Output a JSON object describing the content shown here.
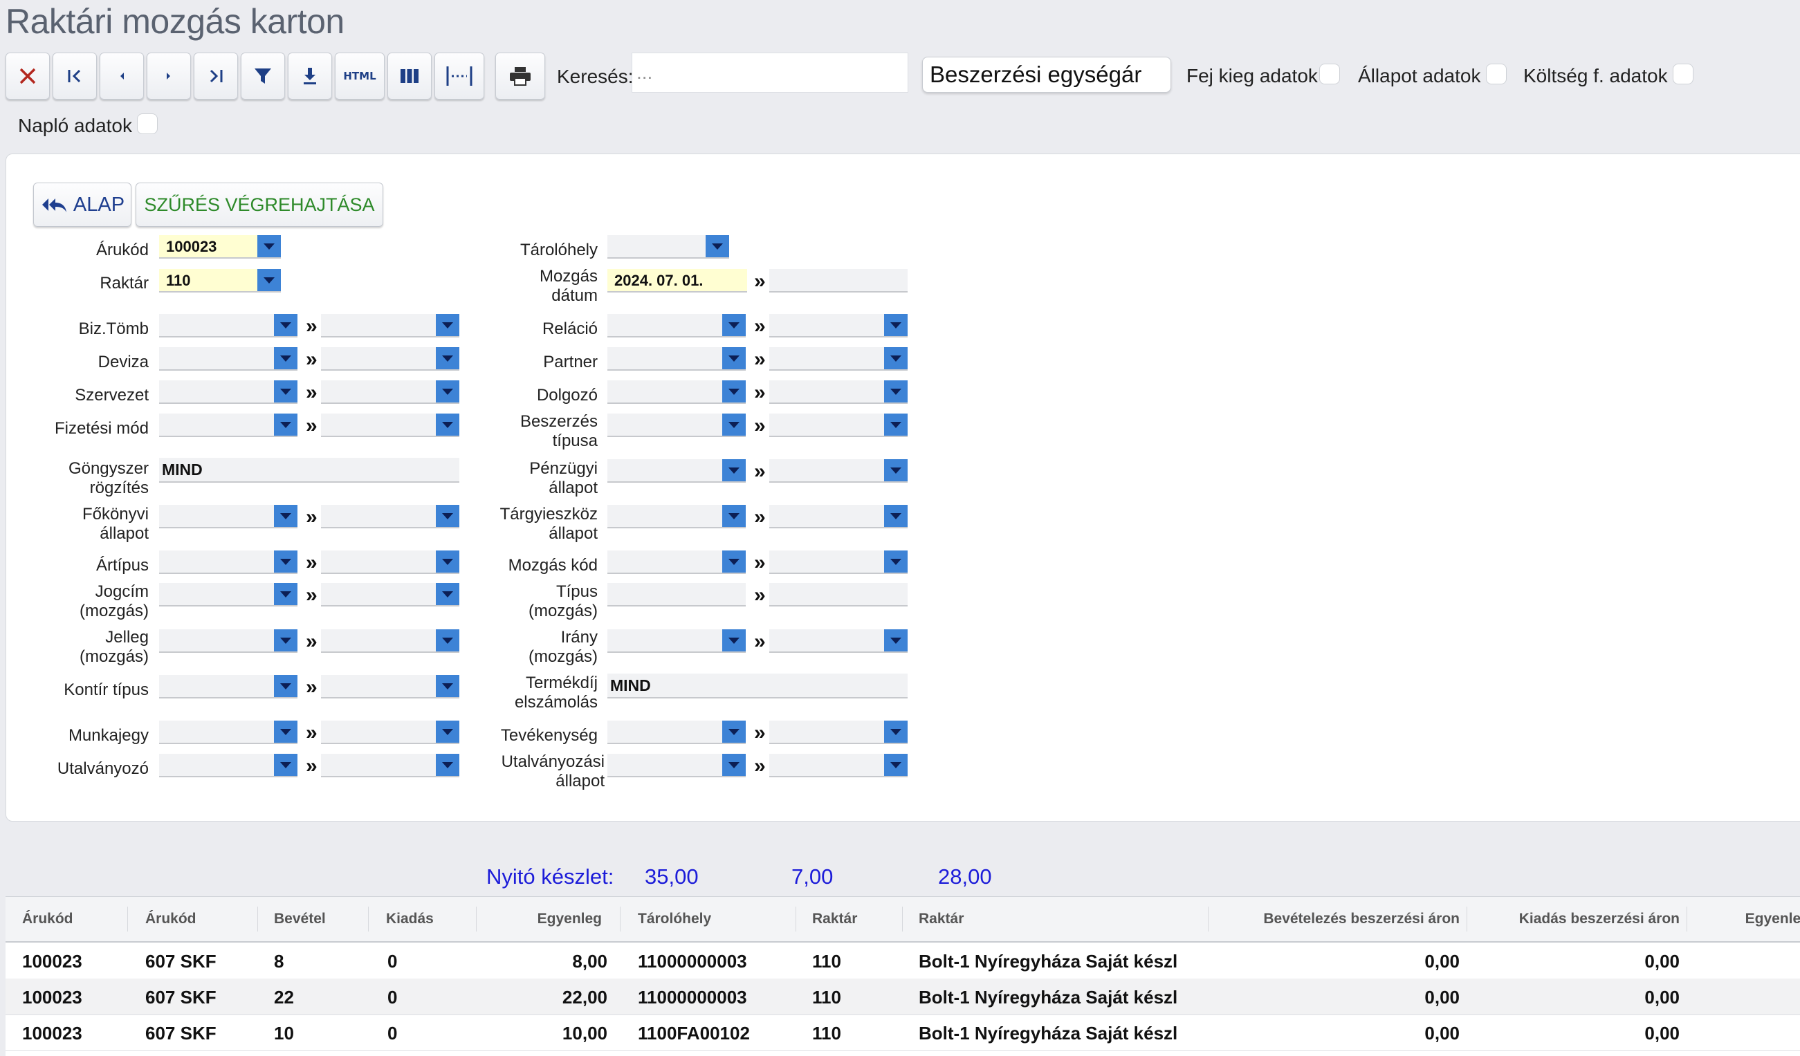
{
  "page": {
    "title": "Raktári mozgás karton"
  },
  "toolbar": {
    "buttons": [
      {
        "icon": "close-icon"
      },
      {
        "icon": "first-page-icon"
      },
      {
        "icon": "prev-icon"
      },
      {
        "icon": "next-icon"
      },
      {
        "icon": "last-page-icon"
      },
      {
        "icon": "filter-icon"
      },
      {
        "icon": "download-icon"
      },
      {
        "icon": "html-export-icon",
        "label": "HTML"
      },
      {
        "icon": "columns-icon"
      },
      {
        "icon": "column-width-icon"
      },
      {
        "icon": "print-icon"
      }
    ],
    "search_label": "Keresés:",
    "search_placeholder": "...",
    "price_select": "Beszerzési egységár",
    "checkboxes": {
      "fej": "Fej kieg adatok",
      "allapot": "Állapot adatok",
      "koltseg": "Költség f. adatok",
      "naplo": "Napló adatok"
    }
  },
  "panel": {
    "alap_label": "ALAP",
    "szures_label": "SZŰRÉS VÉGREHAJTÁSA",
    "left": {
      "arukod": {
        "label": "Árukód",
        "value": "100023"
      },
      "raktar": {
        "label": "Raktár",
        "value": "110"
      },
      "biz_tomb": "Biz.Tömb",
      "deviza": "Deviza",
      "szervezet": "Szervezet",
      "fizetesi_mod": "Fizetési mód",
      "gongyszer": {
        "label1": "Göngyszer",
        "label2": "rögzítés",
        "value": "MIND"
      },
      "fokonyvi": {
        "label1": "Főkönyvi",
        "label2": "állapot"
      },
      "artipus": "Ártípus",
      "jogcim": {
        "label1": "Jogcím",
        "label2": "(mozgás)"
      },
      "jelleg": {
        "label1": "Jelleg",
        "label2": "(mozgás)"
      },
      "kontir": "Kontír típus",
      "munkajegy": "Munkajegy",
      "utalvanyozo": "Utalványozó"
    },
    "right": {
      "tarolohely": "Tárolóhely",
      "mozgas_datum": {
        "label1": "Mozgás",
        "label2": "dátum",
        "value": "2024. 07. 01."
      },
      "relacio": "Reláció",
      "partner": "Partner",
      "dolgozo": "Dolgozó",
      "beszerzes": {
        "label1": "Beszerzés",
        "label2": "típusa"
      },
      "penzugyi": {
        "label1": "Pénzügyi",
        "label2": "állapot"
      },
      "targyieszkoz": {
        "label1": "Tárgyieszköz",
        "label2": "állapot"
      },
      "mozgas_kod": "Mozgás kód",
      "tipus": {
        "label1": "Típus",
        "label2": "(mozgás)"
      },
      "irany": {
        "label1": "Irány",
        "label2": "(mozgás)"
      },
      "termekdij": {
        "label1": "Termékdíj",
        "label2": "elszámolás",
        "value": "MIND"
      },
      "tevekenyseg": "Tevékenység",
      "utalvanyozasi": {
        "label1": "Utalványozási",
        "label2": "állapot"
      }
    },
    "range_sep": "»"
  },
  "summary": {
    "label": "Nyitó készlet:",
    "v1": "35,00",
    "v2": "7,00",
    "v3": "28,00"
  },
  "grid": {
    "headers": [
      "Árukód",
      "Árukód",
      "Bevétel",
      "Kiadás",
      "Egyenleg",
      "Tárolóhely",
      "Raktár",
      "Raktár",
      "Bevételezés beszerzési áron",
      "Kiadás beszerzési áron",
      "Egyenleg"
    ],
    "rows": [
      [
        "100023",
        "607 SKF",
        "8",
        "0",
        "8,00",
        "11000000003",
        "110",
        "Bolt-1 Nyíregyháza Saját készl",
        "0,00",
        "0,00"
      ],
      [
        "100023",
        "607 SKF",
        "22",
        "0",
        "22,00",
        "11000000003",
        "110",
        "Bolt-1 Nyíregyháza Saját készl",
        "0,00",
        "0,00"
      ],
      [
        "100023",
        "607 SKF",
        "10",
        "0",
        "10,00",
        "1100FA00102",
        "110",
        "Bolt-1 Nyíregyháza Saját készl",
        "0,00",
        "0,00"
      ]
    ]
  },
  "colors": {
    "accent": "#3d83d6",
    "summary_blue": "#1c1cd9",
    "filter_green": "#2e8a2a",
    "highlight_yellow": "#fffed2"
  }
}
